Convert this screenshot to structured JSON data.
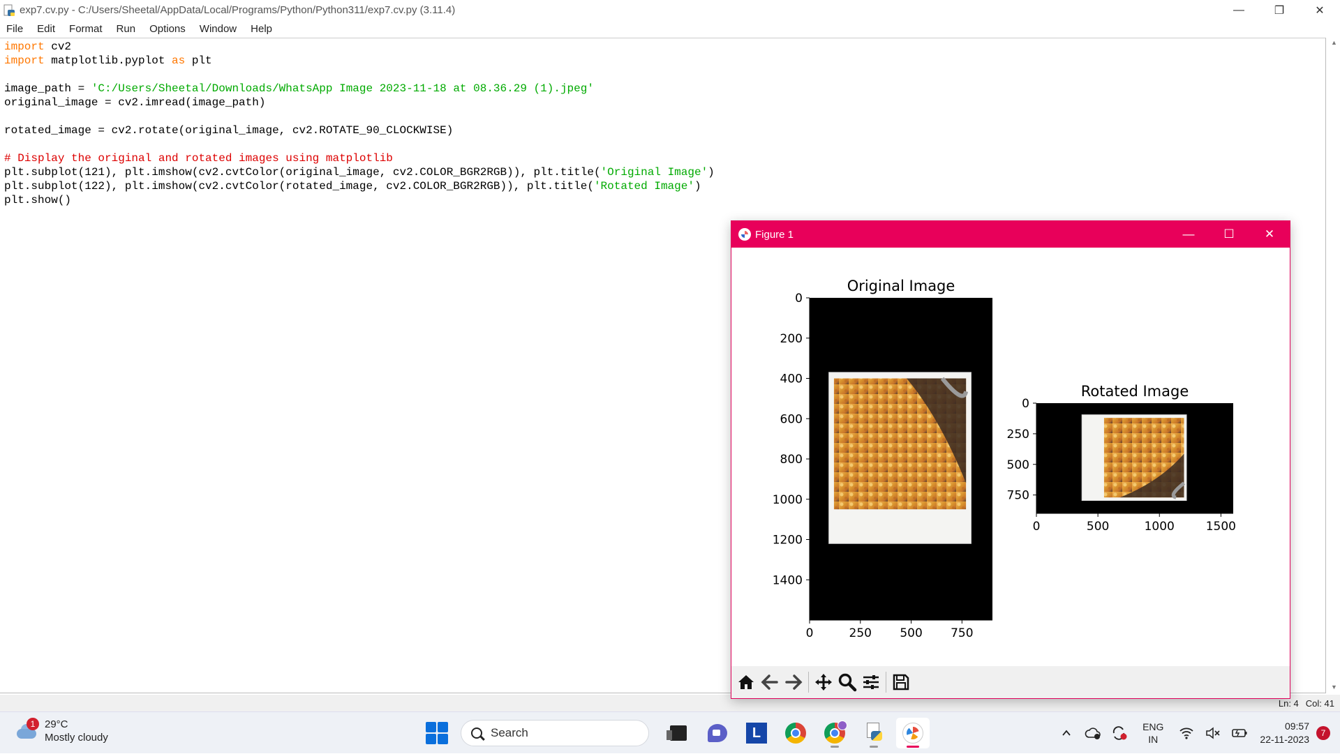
{
  "window": {
    "title": "exp7.cv.py - C:/Users/Sheetal/AppData/Local/Programs/Python/Python311/exp7.cv.py (3.11.4)",
    "controls": {
      "minimize": "—",
      "maximize": "❐",
      "close": "✕"
    }
  },
  "menu": [
    "File",
    "Edit",
    "Format",
    "Run",
    "Options",
    "Window",
    "Help"
  ],
  "code": {
    "l1_kw": "import",
    "l1_rest": " cv2",
    "l2_kw": "import",
    "l2_mid": " matplotlib.pyplot ",
    "l2_kw2": "as",
    "l2_rest": " plt",
    "l4_pre": "image_path = ",
    "l4_str": "'C:/Users/Sheetal/Downloads/WhatsApp Image 2023-11-18 at 08.36.29 (1).jpeg'",
    "l5": "original_image = cv2.imread(image_path)",
    "l7": "rotated_image = cv2.rotate(original_image, cv2.ROTATE_90_CLOCKWISE)",
    "l9_cmt": "# Display the original and rotated images using matplotlib",
    "l10_pre": "plt.subplot(121), plt.imshow(cv2.cvtColor(original_image, cv2.COLOR_BGR2RGB)), plt.title(",
    "l10_str": "'Original Image'",
    "l10_post": ")",
    "l11_pre": "plt.subplot(122), plt.imshow(cv2.cvtColor(rotated_image, cv2.COLOR_BGR2RGB)), plt.title(",
    "l11_str": "'Rotated Image'",
    "l11_post": ")",
    "l12": "plt.show()"
  },
  "status": {
    "line": "Ln: 4",
    "col": "Col: 41"
  },
  "figure": {
    "title": "Figure 1",
    "controls": {
      "minimize": "—",
      "maximize": "☐",
      "close": "✕"
    },
    "toolbar": {
      "home": "⌂",
      "back": "←",
      "forward": "→",
      "pan": "✥",
      "zoom": "⚲",
      "configure": "☰",
      "save": "💾"
    }
  },
  "chart_data": [
    {
      "type": "image",
      "title": "Original Image",
      "xticks": [
        0,
        250,
        500,
        750
      ],
      "yticks": [
        0,
        200,
        400,
        600,
        800,
        1000,
        1200,
        1400
      ],
      "xlim": [
        0,
        900
      ],
      "ylim": [
        1600,
        0
      ],
      "photo_bounds": {
        "x": [
          95,
          795
        ],
        "y": [
          370,
          1220
        ]
      },
      "food_bounds": {
        "x": [
          120,
          770
        ],
        "y": [
          400,
          1050
        ]
      }
    },
    {
      "type": "image",
      "title": "Rotated Image",
      "xticks": [
        0,
        500,
        1000,
        1500
      ],
      "yticks": [
        0,
        250,
        500,
        750
      ],
      "xlim": [
        0,
        1600
      ],
      "ylim": [
        900,
        0
      ],
      "photo_bounds": {
        "x": [
          370,
          1220
        ],
        "y": [
          95,
          795
        ]
      },
      "food_bounds": {
        "x": [
          550,
          1200
        ],
        "y": [
          120,
          770
        ]
      }
    }
  ],
  "taskbar": {
    "weather_badge": "1",
    "temperature": "29°C",
    "condition": "Mostly cloudy",
    "search_label": "Search",
    "lang_top": "ENG",
    "lang_bottom": "IN",
    "time": "09:57",
    "date": "22-11-2023",
    "notifications": "7"
  },
  "colors": {
    "figure_accent": "#e8005a",
    "keyword": "#ff7700",
    "string": "#00aa00",
    "comment": "#dd0000"
  }
}
